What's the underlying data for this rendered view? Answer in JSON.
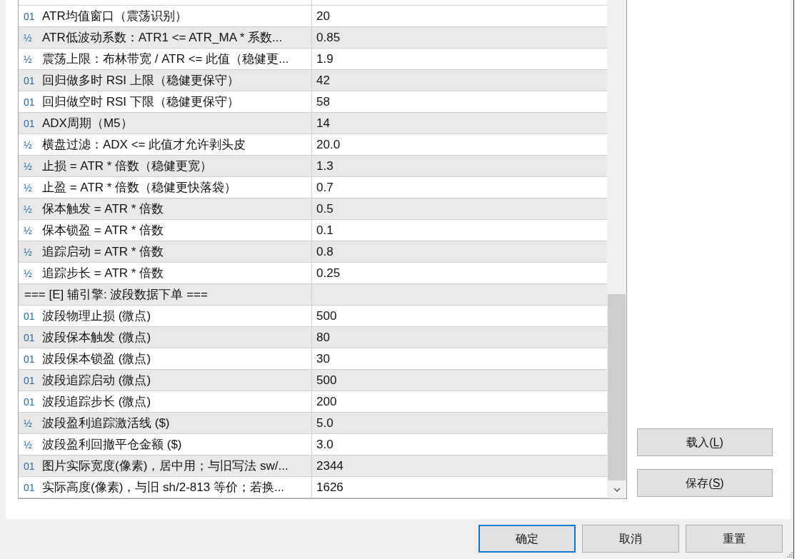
{
  "table": {
    "rows": [
      {
        "kind": "int",
        "type_icon": "01",
        "name": "ATR均值窗口（震荡识别）",
        "value": "20"
      },
      {
        "kind": "double",
        "type_icon": "½",
        "name": "ATR低波动系数：ATR1 <= ATR_MA * 系数...",
        "value": "0.85"
      },
      {
        "kind": "double",
        "type_icon": "½",
        "name": "震荡上限：布林带宽 / ATR <= 此值（稳健更...",
        "value": "1.9"
      },
      {
        "kind": "int",
        "type_icon": "01",
        "name": "回归做多时 RSI 上限（稳健更保守）",
        "value": "42"
      },
      {
        "kind": "int",
        "type_icon": "01",
        "name": "回归做空时 RSI 下限（稳健更保守）",
        "value": "58"
      },
      {
        "kind": "int",
        "type_icon": "01",
        "name": "ADX周期（M5）",
        "value": "14"
      },
      {
        "kind": "double",
        "type_icon": "½",
        "name": "横盘过滤：ADX <= 此值才允许剥头皮",
        "value": "20.0"
      },
      {
        "kind": "double",
        "type_icon": "½",
        "name": "止损 = ATR * 倍数（稳健更宽）",
        "value": "1.3"
      },
      {
        "kind": "double",
        "type_icon": "½",
        "name": "止盈 = ATR * 倍数（稳健更快落袋）",
        "value": "0.7"
      },
      {
        "kind": "double",
        "type_icon": "½",
        "name": "保本触发 = ATR * 倍数",
        "value": "0.5"
      },
      {
        "kind": "double",
        "type_icon": "½",
        "name": "保本锁盈 = ATR * 倍数",
        "value": "0.1"
      },
      {
        "kind": "double",
        "type_icon": "½",
        "name": "追踪启动 = ATR * 倍数",
        "value": "0.8"
      },
      {
        "kind": "double",
        "type_icon": "½",
        "name": "追踪步长 = ATR * 倍数",
        "value": "0.25"
      },
      {
        "kind": "section",
        "name": "=== [E] 辅引擎: 波段数据下单 ==="
      },
      {
        "kind": "int",
        "type_icon": "01",
        "name": "波段物理止损 (微点)",
        "value": "500"
      },
      {
        "kind": "int",
        "type_icon": "01",
        "name": "波段保本触发 (微点)",
        "value": "80"
      },
      {
        "kind": "int",
        "type_icon": "01",
        "name": "波段保本锁盈 (微点)",
        "value": "30"
      },
      {
        "kind": "int",
        "type_icon": "01",
        "name": "波段追踪启动 (微点)",
        "value": "500"
      },
      {
        "kind": "int",
        "type_icon": "01",
        "name": "波段追踪步长 (微点)",
        "value": "200"
      },
      {
        "kind": "double",
        "type_icon": "½",
        "name": "波段盈利追踪激活线 ($)",
        "value": "5.0"
      },
      {
        "kind": "double",
        "type_icon": "½",
        "name": "波段盈利回撤平仓金额 ($)",
        "value": "3.0"
      },
      {
        "kind": "int",
        "type_icon": "01",
        "name": "图片实际宽度(像素)，居中用；与旧写法 sw/...",
        "value": "2344"
      },
      {
        "kind": "int",
        "type_icon": "01",
        "name": "实际高度(像素)，与旧 sh/2-813 等价；若换...",
        "value": "1626"
      }
    ]
  },
  "side_buttons": [
    {
      "label_start": "载入(",
      "mnemonic": "L",
      "label_end": ")"
    },
    {
      "label_start": "保存(",
      "mnemonic": "S",
      "label_end": ")"
    }
  ],
  "dialog_buttons": [
    {
      "label": "确定",
      "default": true
    },
    {
      "label": "取消",
      "default": false
    },
    {
      "label": "重置",
      "default": false
    }
  ]
}
